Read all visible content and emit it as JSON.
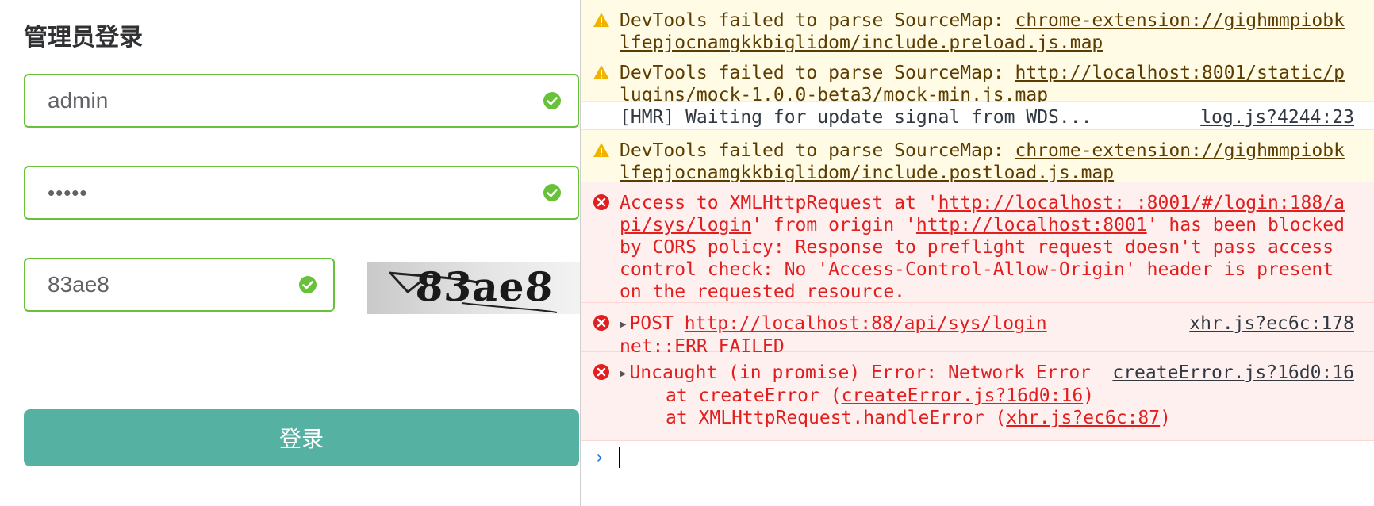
{
  "login": {
    "title": "管理员登录",
    "username_value": "admin",
    "password_mask": "•••••",
    "captcha_input": "83ae8",
    "captcha_image_text": "83ae8",
    "login_button": "登录",
    "valid_icon": "check-circle-icon"
  },
  "console": {
    "messages": [
      {
        "level": "warning",
        "icon": "warning-icon",
        "text": "DevTools failed to parse SourceMap: ",
        "link": "chrome-extension://gighmmpiobklfepjocnamgkkbiglidom/include.preload.js.map"
      },
      {
        "level": "warning",
        "icon": "warning-icon",
        "text": "DevTools failed to parse SourceMap: ",
        "link": "http://localhost:8001/static/plugins/mock-1.0.0-beta3/mock-min.js.map"
      },
      {
        "level": "log",
        "text": "[HMR] Waiting for update signal from WDS...",
        "source": "log.js?4244:23"
      },
      {
        "level": "warning",
        "icon": "warning-icon",
        "text": "DevTools failed to parse SourceMap: ",
        "link": "chrome-extension://gighmmpiobklfepjocnamgkkbiglidom/include.postload.js.map"
      },
      {
        "level": "error",
        "icon": "error-icon",
        "pre": "Access to XMLHttpRequest at '",
        "link1": "http://localhost: :8001/#/login:188/api/sys/login",
        "mid": "' from origin '",
        "link2": "http://localhost:8001",
        "post": "' has been blocked by CORS policy: Response to preflight request doesn't pass access control check: No 'Access-Control-Allow-Origin' header is present on the requested resource."
      },
      {
        "level": "error",
        "icon": "error-icon",
        "method": "POST ",
        "link": "http://localhost:88/api/sys/login",
        "source": "xhr.js?ec6c:178",
        "detail": "net::ERR_FAILED"
      },
      {
        "level": "error",
        "icon": "error-icon",
        "text": "Uncaught (in promise) Error: Network Error",
        "source": "createError.js?16d0:16",
        "stack": [
          {
            "pre": "at createError (",
            "link": "createError.js?16d0:16",
            "post": ")"
          },
          {
            "pre": "at XMLHttpRequest.handleError (",
            "link": "xhr.js?ec6c:87",
            "post": ")"
          }
        ]
      }
    ],
    "prompt_icon": "chevron-right-icon"
  }
}
